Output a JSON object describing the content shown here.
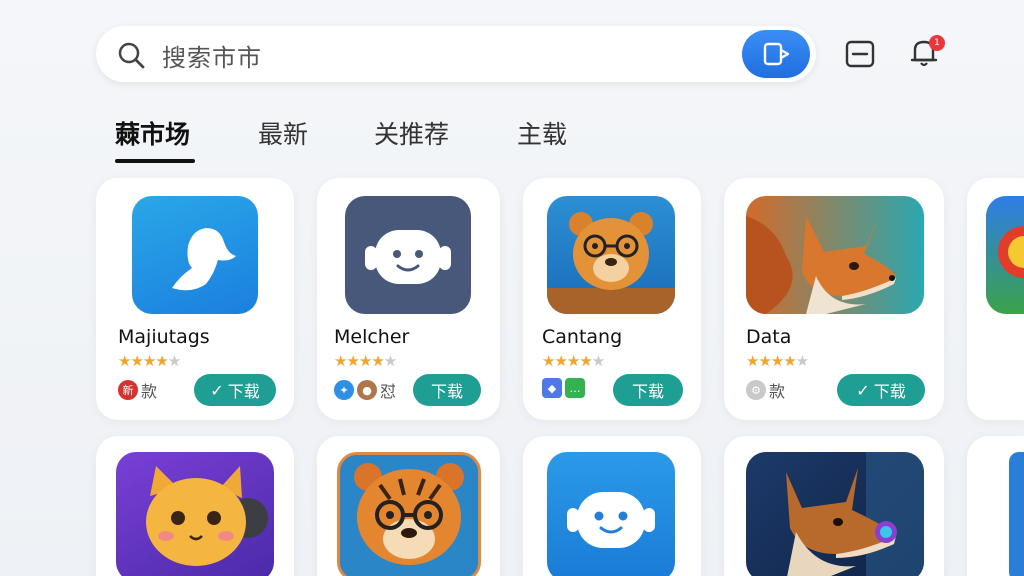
{
  "search": {
    "placeholder": "搜索市市"
  },
  "header": {
    "notification_count": "1"
  },
  "tabs": [
    {
      "label": "蕀市场"
    },
    {
      "label": "最新"
    },
    {
      "label": "关推荐"
    },
    {
      "label": "主载"
    }
  ],
  "apps": [
    {
      "name": "Majiutags",
      "rating": 4,
      "meta_text": "款",
      "mini_icon_text": "新",
      "download_label": "下载",
      "check": "✓"
    },
    {
      "name": "Melcher",
      "rating": 4,
      "meta_text": "怼",
      "download_label": "下载",
      "check": ""
    },
    {
      "name": "Cantang",
      "rating": 4,
      "meta_text": "",
      "download_label": "下载",
      "check": ""
    },
    {
      "name": "Data",
      "rating": 4,
      "meta_text": "款",
      "download_label": "下载",
      "check": "✓"
    }
  ],
  "colors": {
    "accent": "#1f9e93",
    "search_button": "#2f7fee",
    "badge": "#e8363a",
    "star": "#f0a62c"
  }
}
